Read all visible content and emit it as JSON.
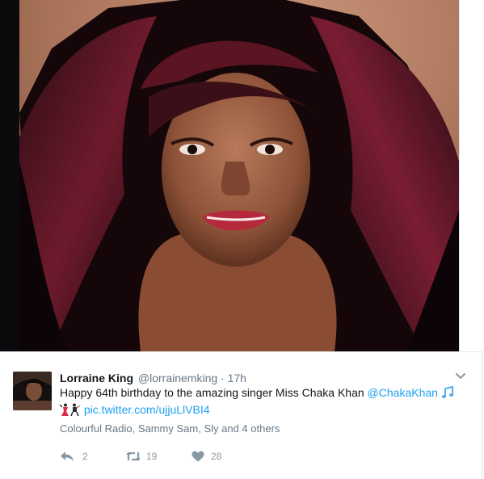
{
  "media": {
    "alt": "photo"
  },
  "tweet": {
    "author_name": "Lorraine King",
    "author_handle": "@lorrainemking",
    "separator": "·",
    "timestamp": "17h",
    "text_prefix": "Happy 64th birthday to the amazing singer Miss Chaka Khan ",
    "mention": "@ChakaKhan",
    "pic_link": "pic.twitter.com/ujjuLlVBI4",
    "liked_by": "Colourful Radio, Sammy Sam, Sly and 4 others",
    "reply_count": "2",
    "retweet_count": "19",
    "like_count": "28"
  },
  "icons": {
    "more": "chevron-down-icon",
    "reply": "reply-icon",
    "retweet": "retweet-icon",
    "like": "heart-icon",
    "music": "musical-notes-emoji",
    "dancer": "dancer-emoji",
    "singer": "singer-emoji"
  },
  "colors": {
    "link": "#1da1f2",
    "text": "#14171a",
    "muted": "#657786",
    "action": "#8899a6"
  }
}
